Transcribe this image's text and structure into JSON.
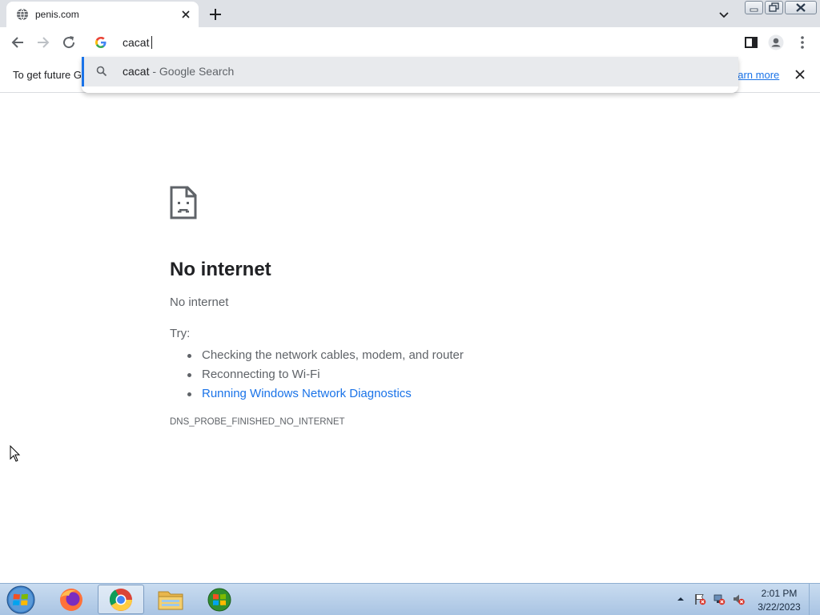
{
  "tab": {
    "title": "penis.com",
    "favicon": "globe-icon"
  },
  "omnibox": {
    "value": "cacat"
  },
  "suggestion": {
    "query": "cacat",
    "separator": " - ",
    "source": "Google Search"
  },
  "infobar": {
    "text": "To get future G",
    "link": "earn more"
  },
  "error": {
    "title": "No internet",
    "subtitle": "No internet",
    "try_label": "Try:",
    "suggestions": [
      "Checking the network cables, modem, and router",
      "Reconnecting to Wi-Fi",
      "Running Windows Network Diagnostics"
    ],
    "code": "DNS_PROBE_FINISHED_NO_INTERNET"
  },
  "taskbar": {
    "apps": [
      "firefox-icon",
      "chrome-icon",
      "file-explorer-icon",
      "windows-media-icon"
    ],
    "clock": {
      "time": "2:01 PM",
      "date": "3/22/2023"
    }
  },
  "colors": {
    "accent": "#1a73e8",
    "tabstrip": "#dee1e6",
    "text": "#202124",
    "muted": "#5f6368"
  }
}
